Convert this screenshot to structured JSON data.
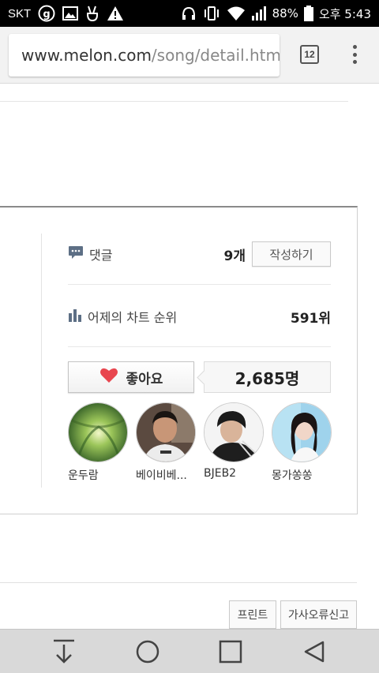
{
  "status_bar": {
    "carrier": "SKT",
    "battery": "88%",
    "time": "오후 5:43",
    "icons": [
      "g-circle-icon",
      "image-icon",
      "peace-hand-icon",
      "warning-icon",
      "headphones-icon",
      "vibrate-icon",
      "wifi-icon",
      "signal-icon",
      "battery-icon"
    ]
  },
  "browser": {
    "url_host": "www.melon.com",
    "url_path": "/song/detail.htm",
    "tab_count": "12"
  },
  "song_info": {
    "comment_label": "댓글",
    "comment_count": "9개",
    "write_button": "작성하기",
    "rank_label": "어제의 차트 순위",
    "rank_value": "591위",
    "like_button": "좋아요",
    "like_count": "2,685명",
    "fans": [
      {
        "name": "운두람"
      },
      {
        "name": "베이비베..."
      },
      {
        "name": "BJEB2"
      },
      {
        "name": "몽가쏭쏭"
      }
    ]
  },
  "footer": {
    "print_button": "프린트",
    "report_button": "가사오류신고"
  },
  "colors": {
    "heart": "#e8464f",
    "nav_bar": "#d9d9d9"
  }
}
